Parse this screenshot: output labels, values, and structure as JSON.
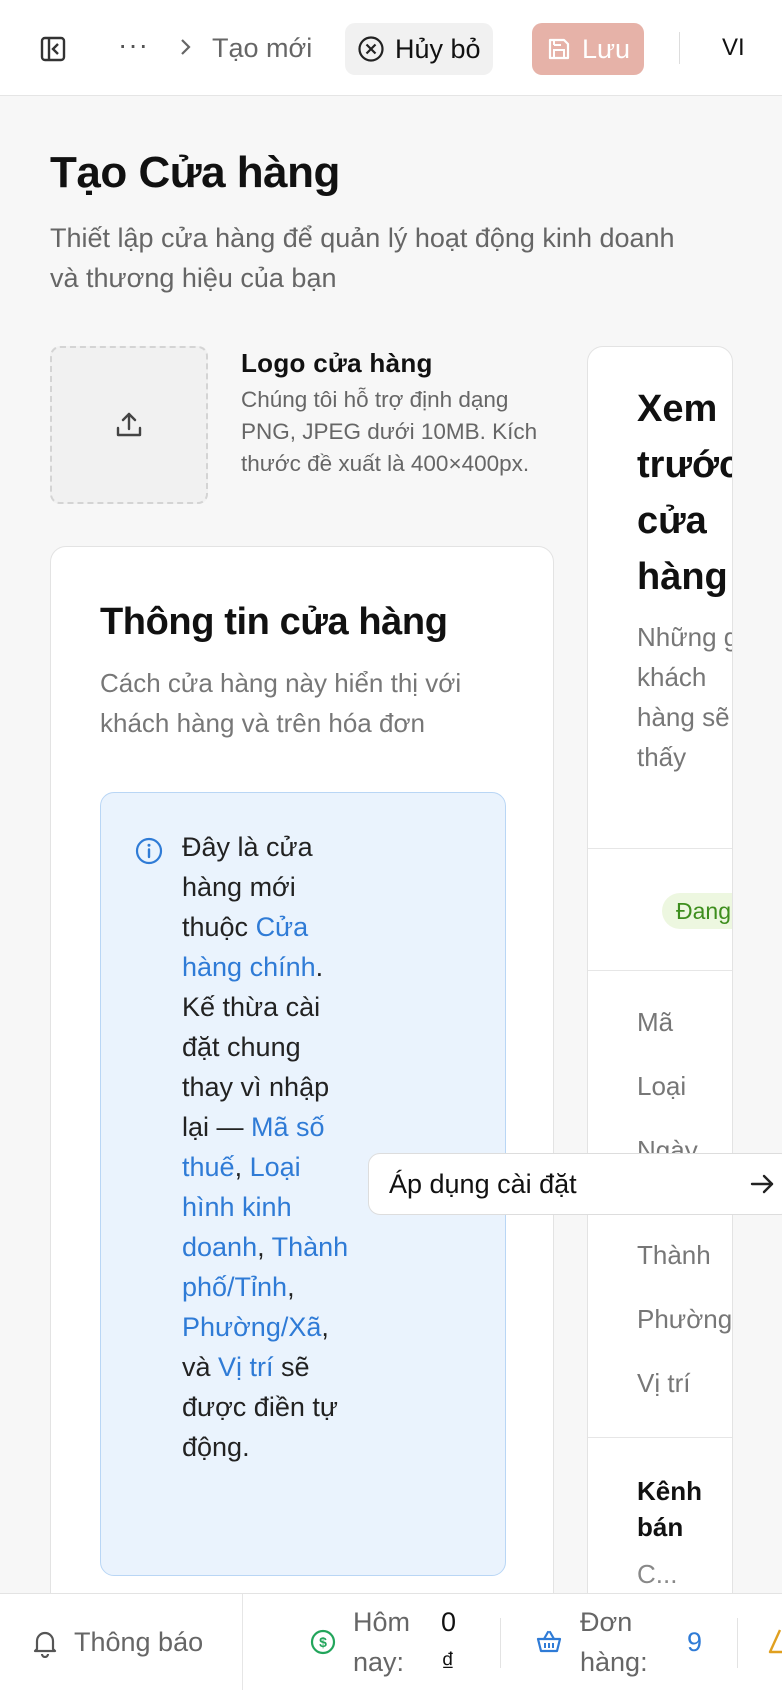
{
  "topbar": {
    "breadcrumb_more": "···",
    "breadcrumb_current": "Tạo mới",
    "cancel_label": "Hủy bỏ",
    "save_label": "Lưu",
    "language": "VI"
  },
  "page": {
    "title": "Tạo Cửa hàng",
    "subtitle": "Thiết lập cửa hàng để quản lý hoạt động kinh doanh và thương hiệu của bạn"
  },
  "logo": {
    "title": "Logo cửa hàng",
    "description": "Chúng tôi hỗ trợ định dạng PNG, JPEG dưới 10MB. Kích thước đề xuất là 400×400px."
  },
  "store_info": {
    "title": "Thông tin cửa hàng",
    "subtitle": "Cách cửa hàng này hiển thị với khách hàng và trên hóa đơn",
    "notice": {
      "t1": "Đây là cửa hàng mới thuộc ",
      "parent": "Cửa hàng chính",
      "t2": ". Kế thừa cài đặt chung thay vì nhập lại — ",
      "f1": "Mã số thuế",
      "sep1": ", ",
      "f2": "Loại hình kinh doanh",
      "sep2": ", ",
      "f3": "Thành phố/Tỉnh",
      "sep3": ", ",
      "f4": "Phường/Xã",
      "sep4": ", và ",
      "f5": "Vị trí",
      "t3": " sẽ được điền tự động."
    },
    "apply_label": "Áp dụng cài đặt"
  },
  "preview": {
    "title": "Xem trước cửa hàng",
    "subtitle": "Những gì khách hàng sẽ thấy",
    "status": "Đang hoạt động",
    "rows_a": [
      "Mã",
      "Loại",
      "Ngày"
    ],
    "rows_b": [
      "Thành",
      "Phường",
      "Vị trí"
    ],
    "channels_title": "Kênh bán",
    "channels_value": "C..."
  },
  "bottombar": {
    "notifications": "Thông báo",
    "today_label": "Hôm nay:",
    "today_value": "0 ₫",
    "orders_label": "Đơn hàng:",
    "orders_value": "9"
  },
  "colors": {
    "accent_save": "#e6b2a8",
    "link": "#2f7bd6",
    "status_green": "#3e8e1e",
    "money_icon": "#22a55b"
  }
}
